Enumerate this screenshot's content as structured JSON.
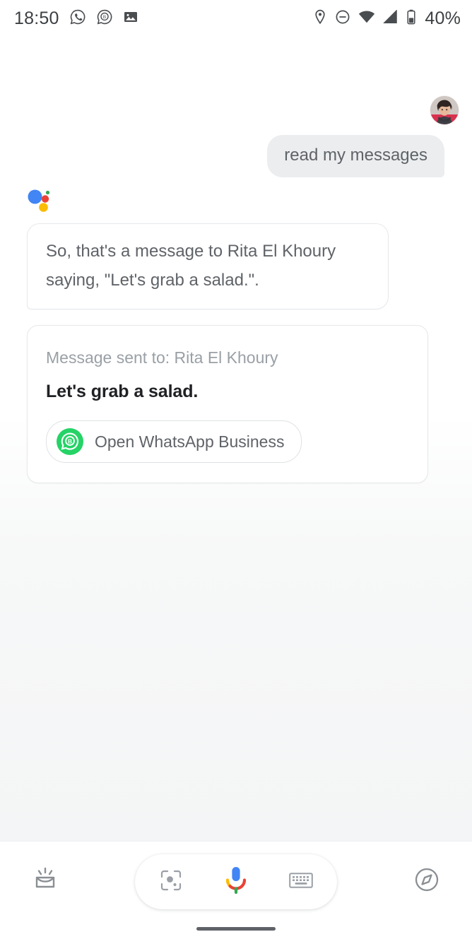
{
  "status_bar": {
    "time": "18:50",
    "battery_percent": "40%",
    "left_icons": [
      "whatsapp-notification-icon",
      "whatsapp-business-notification-icon",
      "photo-notification-icon"
    ],
    "right_icons": [
      "location-icon",
      "do-not-disturb-icon",
      "wifi-icon",
      "cell-signal-icon",
      "battery-icon"
    ]
  },
  "conversation": {
    "user_message": "read my messages",
    "assistant_logo": "google-assistant-logo",
    "assistant_message": "So, that's a message to Rita El Khoury saying, \"Let's grab a salad.\".",
    "card": {
      "label": "Message sent to: Rita El Khoury",
      "message": "Let's grab a salad.",
      "action_label": "Open WhatsApp Business",
      "action_icon": "whatsapp-business-icon"
    }
  },
  "bottom_bar": {
    "snapshot_icon": "snapshot-icon",
    "lens_icon": "google-lens-icon",
    "mic_icon": "google-mic-icon",
    "keyboard_icon": "keyboard-icon",
    "explore_icon": "explore-compass-icon"
  },
  "colors": {
    "google_blue": "#4285F4",
    "google_red": "#EA4335",
    "google_yellow": "#FBBC05",
    "google_green": "#34A853",
    "whatsapp_green": "#25D366",
    "text_primary": "#202124",
    "text_secondary": "#5f6368",
    "text_muted": "#9aa0a6",
    "user_bubble_bg": "#ebedef"
  }
}
